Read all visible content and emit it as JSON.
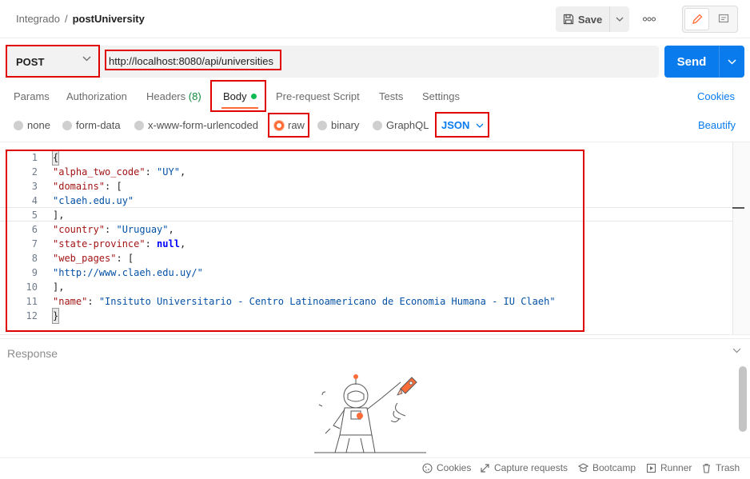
{
  "header": {
    "breadcrumb_workspace": "Integrado",
    "breadcrumb_separator": "/",
    "request_name": "postUniversity",
    "save_label": "Save",
    "more_label": "ooo"
  },
  "request": {
    "method": "POST",
    "url": "http://localhost:8080/api/universities",
    "send_label": "Send"
  },
  "tabs": [
    {
      "label": "Params"
    },
    {
      "label": "Authorization"
    },
    {
      "label": "Headers",
      "count": "(8)"
    },
    {
      "label": "Body"
    },
    {
      "label": "Pre-request Script"
    },
    {
      "label": "Tests"
    },
    {
      "label": "Settings"
    }
  ],
  "cookies_link": "Cookies",
  "body_options": [
    {
      "label": "none"
    },
    {
      "label": "form-data"
    },
    {
      "label": "x-www-form-urlencoded"
    },
    {
      "label": "raw",
      "selected": true
    },
    {
      "label": "binary"
    },
    {
      "label": "GraphQL"
    }
  ],
  "body_format": "JSON",
  "beautify_label": "Beautify",
  "editor": {
    "line_numbers": [
      "1",
      "2",
      "3",
      "4",
      "5",
      "6",
      "7",
      "8",
      "9",
      "10",
      "11",
      "12"
    ],
    "lines": [
      "{",
      "\"alpha_two_code\": \"UY\",",
      "\"domains\": [",
      "\"claeh.edu.uy\"",
      "],",
      "\"country\": \"Uruguay\",",
      "\"state-province\": null,",
      "\"web_pages\": [",
      "\"http://www.claeh.edu.uy/\"",
      "],",
      "\"name\": \"Insituto Universitario - Centro Latinoamericano de Economia Humana - IU Claeh\"",
      "}"
    ]
  },
  "response": {
    "title": "Response"
  },
  "statusbar": [
    {
      "label": "Cookies",
      "icon": "cookie-icon"
    },
    {
      "label": "Capture requests",
      "icon": "capture-icon"
    },
    {
      "label": "Bootcamp",
      "icon": "bootcamp-icon"
    },
    {
      "label": "Runner",
      "icon": "runner-icon"
    },
    {
      "label": "Trash",
      "icon": "trash-icon"
    }
  ],
  "colors": {
    "accent_orange": "#ff6c37",
    "send_blue": "#097bed",
    "annotation_red": "#e00000"
  }
}
